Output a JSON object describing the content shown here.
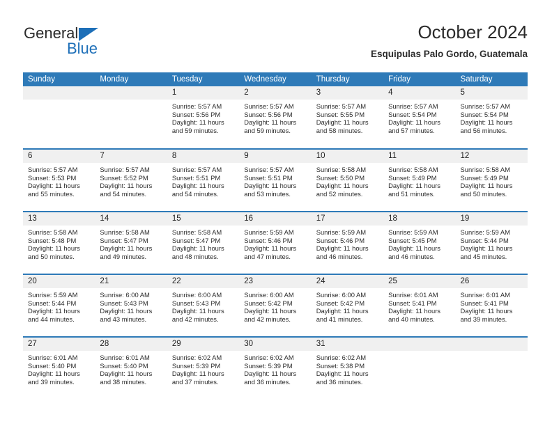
{
  "brand": {
    "name_top": "General",
    "name_bottom": "Blue",
    "accent_color": "#1d6fb8"
  },
  "header": {
    "title": "October 2024",
    "subtitle": "Esquipulas Palo Gordo, Guatemala"
  },
  "colors": {
    "header_row_bg": "#2e7ab8",
    "header_row_text": "#ffffff",
    "daynum_bg": "#f0f0f0",
    "row_divider": "#2e7ab8",
    "body_text": "#2b2b2b"
  },
  "weekdays": [
    "Sunday",
    "Monday",
    "Tuesday",
    "Wednesday",
    "Thursday",
    "Friday",
    "Saturday"
  ],
  "weeks": [
    [
      {
        "day": "",
        "sunrise": "",
        "sunset": "",
        "daylight_line1": "",
        "daylight_line2": ""
      },
      {
        "day": "",
        "sunrise": "",
        "sunset": "",
        "daylight_line1": "",
        "daylight_line2": ""
      },
      {
        "day": "1",
        "sunrise": "Sunrise: 5:57 AM",
        "sunset": "Sunset: 5:56 PM",
        "daylight_line1": "Daylight: 11 hours",
        "daylight_line2": "and 59 minutes."
      },
      {
        "day": "2",
        "sunrise": "Sunrise: 5:57 AM",
        "sunset": "Sunset: 5:56 PM",
        "daylight_line1": "Daylight: 11 hours",
        "daylight_line2": "and 59 minutes."
      },
      {
        "day": "3",
        "sunrise": "Sunrise: 5:57 AM",
        "sunset": "Sunset: 5:55 PM",
        "daylight_line1": "Daylight: 11 hours",
        "daylight_line2": "and 58 minutes."
      },
      {
        "day": "4",
        "sunrise": "Sunrise: 5:57 AM",
        "sunset": "Sunset: 5:54 PM",
        "daylight_line1": "Daylight: 11 hours",
        "daylight_line2": "and 57 minutes."
      },
      {
        "day": "5",
        "sunrise": "Sunrise: 5:57 AM",
        "sunset": "Sunset: 5:54 PM",
        "daylight_line1": "Daylight: 11 hours",
        "daylight_line2": "and 56 minutes."
      }
    ],
    [
      {
        "day": "6",
        "sunrise": "Sunrise: 5:57 AM",
        "sunset": "Sunset: 5:53 PM",
        "daylight_line1": "Daylight: 11 hours",
        "daylight_line2": "and 55 minutes."
      },
      {
        "day": "7",
        "sunrise": "Sunrise: 5:57 AM",
        "sunset": "Sunset: 5:52 PM",
        "daylight_line1": "Daylight: 11 hours",
        "daylight_line2": "and 54 minutes."
      },
      {
        "day": "8",
        "sunrise": "Sunrise: 5:57 AM",
        "sunset": "Sunset: 5:51 PM",
        "daylight_line1": "Daylight: 11 hours",
        "daylight_line2": "and 54 minutes."
      },
      {
        "day": "9",
        "sunrise": "Sunrise: 5:57 AM",
        "sunset": "Sunset: 5:51 PM",
        "daylight_line1": "Daylight: 11 hours",
        "daylight_line2": "and 53 minutes."
      },
      {
        "day": "10",
        "sunrise": "Sunrise: 5:58 AM",
        "sunset": "Sunset: 5:50 PM",
        "daylight_line1": "Daylight: 11 hours",
        "daylight_line2": "and 52 minutes."
      },
      {
        "day": "11",
        "sunrise": "Sunrise: 5:58 AM",
        "sunset": "Sunset: 5:49 PM",
        "daylight_line1": "Daylight: 11 hours",
        "daylight_line2": "and 51 minutes."
      },
      {
        "day": "12",
        "sunrise": "Sunrise: 5:58 AM",
        "sunset": "Sunset: 5:49 PM",
        "daylight_line1": "Daylight: 11 hours",
        "daylight_line2": "and 50 minutes."
      }
    ],
    [
      {
        "day": "13",
        "sunrise": "Sunrise: 5:58 AM",
        "sunset": "Sunset: 5:48 PM",
        "daylight_line1": "Daylight: 11 hours",
        "daylight_line2": "and 50 minutes."
      },
      {
        "day": "14",
        "sunrise": "Sunrise: 5:58 AM",
        "sunset": "Sunset: 5:47 PM",
        "daylight_line1": "Daylight: 11 hours",
        "daylight_line2": "and 49 minutes."
      },
      {
        "day": "15",
        "sunrise": "Sunrise: 5:58 AM",
        "sunset": "Sunset: 5:47 PM",
        "daylight_line1": "Daylight: 11 hours",
        "daylight_line2": "and 48 minutes."
      },
      {
        "day": "16",
        "sunrise": "Sunrise: 5:59 AM",
        "sunset": "Sunset: 5:46 PM",
        "daylight_line1": "Daylight: 11 hours",
        "daylight_line2": "and 47 minutes."
      },
      {
        "day": "17",
        "sunrise": "Sunrise: 5:59 AM",
        "sunset": "Sunset: 5:46 PM",
        "daylight_line1": "Daylight: 11 hours",
        "daylight_line2": "and 46 minutes."
      },
      {
        "day": "18",
        "sunrise": "Sunrise: 5:59 AM",
        "sunset": "Sunset: 5:45 PM",
        "daylight_line1": "Daylight: 11 hours",
        "daylight_line2": "and 46 minutes."
      },
      {
        "day": "19",
        "sunrise": "Sunrise: 5:59 AM",
        "sunset": "Sunset: 5:44 PM",
        "daylight_line1": "Daylight: 11 hours",
        "daylight_line2": "and 45 minutes."
      }
    ],
    [
      {
        "day": "20",
        "sunrise": "Sunrise: 5:59 AM",
        "sunset": "Sunset: 5:44 PM",
        "daylight_line1": "Daylight: 11 hours",
        "daylight_line2": "and 44 minutes."
      },
      {
        "day": "21",
        "sunrise": "Sunrise: 6:00 AM",
        "sunset": "Sunset: 5:43 PM",
        "daylight_line1": "Daylight: 11 hours",
        "daylight_line2": "and 43 minutes."
      },
      {
        "day": "22",
        "sunrise": "Sunrise: 6:00 AM",
        "sunset": "Sunset: 5:43 PM",
        "daylight_line1": "Daylight: 11 hours",
        "daylight_line2": "and 42 minutes."
      },
      {
        "day": "23",
        "sunrise": "Sunrise: 6:00 AM",
        "sunset": "Sunset: 5:42 PM",
        "daylight_line1": "Daylight: 11 hours",
        "daylight_line2": "and 42 minutes."
      },
      {
        "day": "24",
        "sunrise": "Sunrise: 6:00 AM",
        "sunset": "Sunset: 5:42 PM",
        "daylight_line1": "Daylight: 11 hours",
        "daylight_line2": "and 41 minutes."
      },
      {
        "day": "25",
        "sunrise": "Sunrise: 6:01 AM",
        "sunset": "Sunset: 5:41 PM",
        "daylight_line1": "Daylight: 11 hours",
        "daylight_line2": "and 40 minutes."
      },
      {
        "day": "26",
        "sunrise": "Sunrise: 6:01 AM",
        "sunset": "Sunset: 5:41 PM",
        "daylight_line1": "Daylight: 11 hours",
        "daylight_line2": "and 39 minutes."
      }
    ],
    [
      {
        "day": "27",
        "sunrise": "Sunrise: 6:01 AM",
        "sunset": "Sunset: 5:40 PM",
        "daylight_line1": "Daylight: 11 hours",
        "daylight_line2": "and 39 minutes."
      },
      {
        "day": "28",
        "sunrise": "Sunrise: 6:01 AM",
        "sunset": "Sunset: 5:40 PM",
        "daylight_line1": "Daylight: 11 hours",
        "daylight_line2": "and 38 minutes."
      },
      {
        "day": "29",
        "sunrise": "Sunrise: 6:02 AM",
        "sunset": "Sunset: 5:39 PM",
        "daylight_line1": "Daylight: 11 hours",
        "daylight_line2": "and 37 minutes."
      },
      {
        "day": "30",
        "sunrise": "Sunrise: 6:02 AM",
        "sunset": "Sunset: 5:39 PM",
        "daylight_line1": "Daylight: 11 hours",
        "daylight_line2": "and 36 minutes."
      },
      {
        "day": "31",
        "sunrise": "Sunrise: 6:02 AM",
        "sunset": "Sunset: 5:38 PM",
        "daylight_line1": "Daylight: 11 hours",
        "daylight_line2": "and 36 minutes."
      },
      {
        "day": "",
        "sunrise": "",
        "sunset": "",
        "daylight_line1": "",
        "daylight_line2": ""
      },
      {
        "day": "",
        "sunrise": "",
        "sunset": "",
        "daylight_line1": "",
        "daylight_line2": ""
      }
    ]
  ]
}
